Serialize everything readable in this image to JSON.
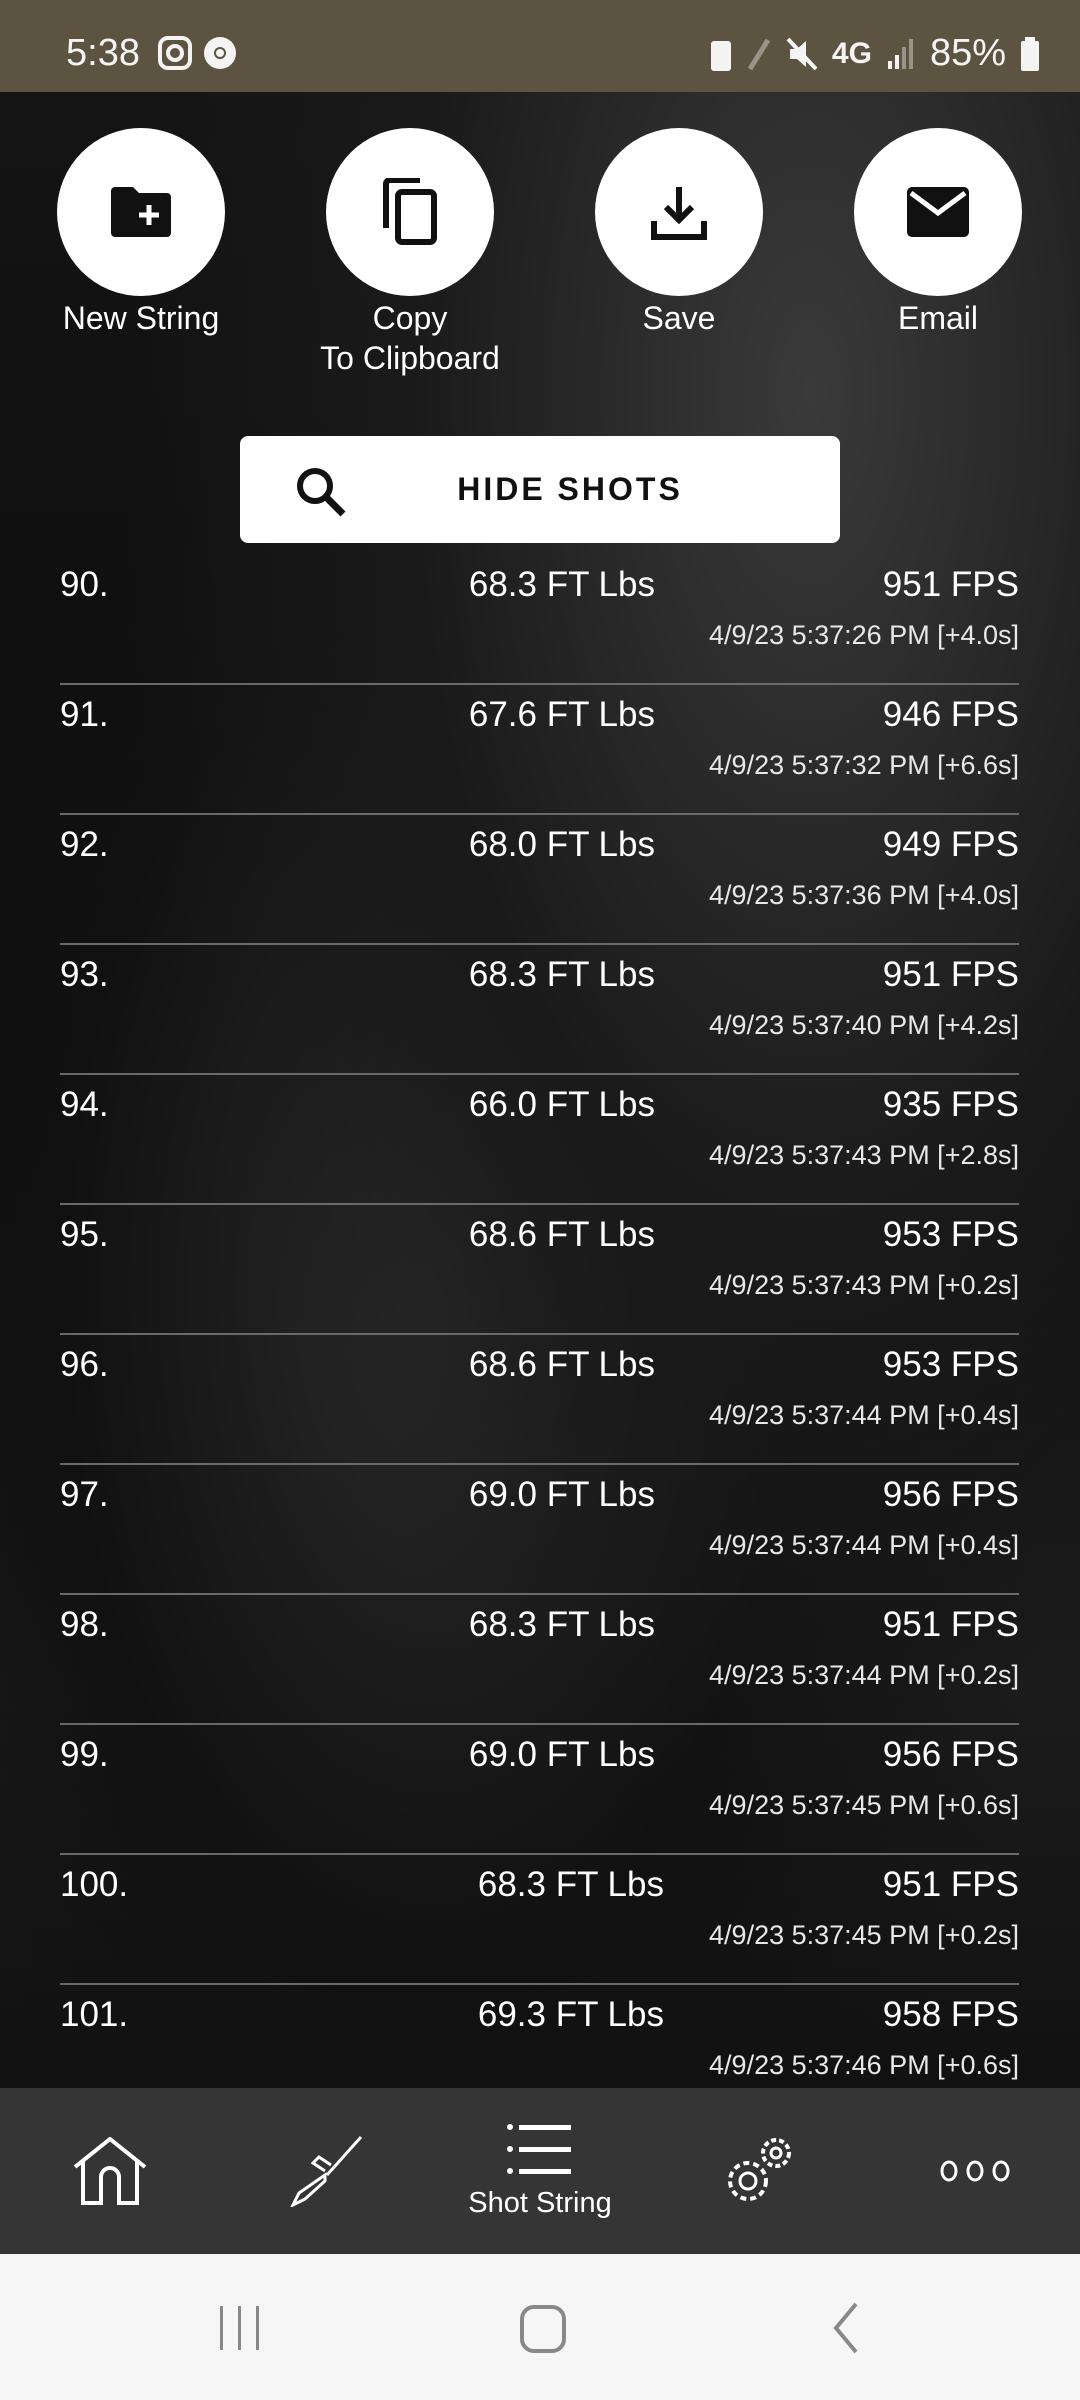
{
  "status_bar": {
    "time": "5:38",
    "battery": "85%",
    "network": "4G"
  },
  "actions": [
    {
      "label": "New String",
      "icon": "folder-plus-icon"
    },
    {
      "label": "Copy\nTo Clipboard",
      "icon": "copy-icon"
    },
    {
      "label": "Save",
      "icon": "download-icon"
    },
    {
      "label": "Email",
      "icon": "mail-icon"
    }
  ],
  "hide_shots": {
    "label": "HIDE SHOTS",
    "icon": "search-icon"
  },
  "shots": [
    {
      "num": "90.",
      "energy": "68.3 FT Lbs",
      "fps": "951 FPS",
      "time": "4/9/23 5:37:26 PM [+4.0s]"
    },
    {
      "num": "91.",
      "energy": "67.6 FT Lbs",
      "fps": "946 FPS",
      "time": "4/9/23 5:37:32 PM [+6.6s]"
    },
    {
      "num": "92.",
      "energy": "68.0 FT Lbs",
      "fps": "949 FPS",
      "time": "4/9/23 5:37:36 PM [+4.0s]"
    },
    {
      "num": "93.",
      "energy": "68.3 FT Lbs",
      "fps": "951 FPS",
      "time": "4/9/23 5:37:40 PM [+4.2s]"
    },
    {
      "num": "94.",
      "energy": "66.0 FT Lbs",
      "fps": "935 FPS",
      "time": "4/9/23 5:37:43 PM [+2.8s]"
    },
    {
      "num": "95.",
      "energy": "68.6 FT Lbs",
      "fps": "953 FPS",
      "time": "4/9/23 5:37:43 PM [+0.2s]"
    },
    {
      "num": "96.",
      "energy": "68.6 FT Lbs",
      "fps": "953 FPS",
      "time": "4/9/23 5:37:44 PM [+0.4s]"
    },
    {
      "num": "97.",
      "energy": "69.0 FT Lbs",
      "fps": "956 FPS",
      "time": "4/9/23 5:37:44 PM [+0.4s]"
    },
    {
      "num": "98.",
      "energy": "68.3 FT Lbs",
      "fps": "951 FPS",
      "time": "4/9/23 5:37:44 PM [+0.2s]"
    },
    {
      "num": "99.",
      "energy": "69.0 FT Lbs",
      "fps": "956 FPS",
      "time": "4/9/23 5:37:45 PM [+0.6s]"
    },
    {
      "num": "100.",
      "energy": "68.3 FT Lbs",
      "fps": "951 FPS",
      "time": "4/9/23 5:37:45 PM [+0.2s]"
    },
    {
      "num": "101.",
      "energy": "69.3 FT Lbs",
      "fps": "958 FPS",
      "time": "4/9/23 5:37:46 PM [+0.6s]"
    }
  ],
  "bottom_nav": {
    "items": [
      {
        "icon": "home-icon",
        "label": ""
      },
      {
        "icon": "rifle-icon",
        "label": ""
      },
      {
        "icon": "list-icon",
        "label": "Shot String"
      },
      {
        "icon": "gears-icon",
        "label": ""
      },
      {
        "icon": "more-icon",
        "label": ""
      }
    ]
  }
}
